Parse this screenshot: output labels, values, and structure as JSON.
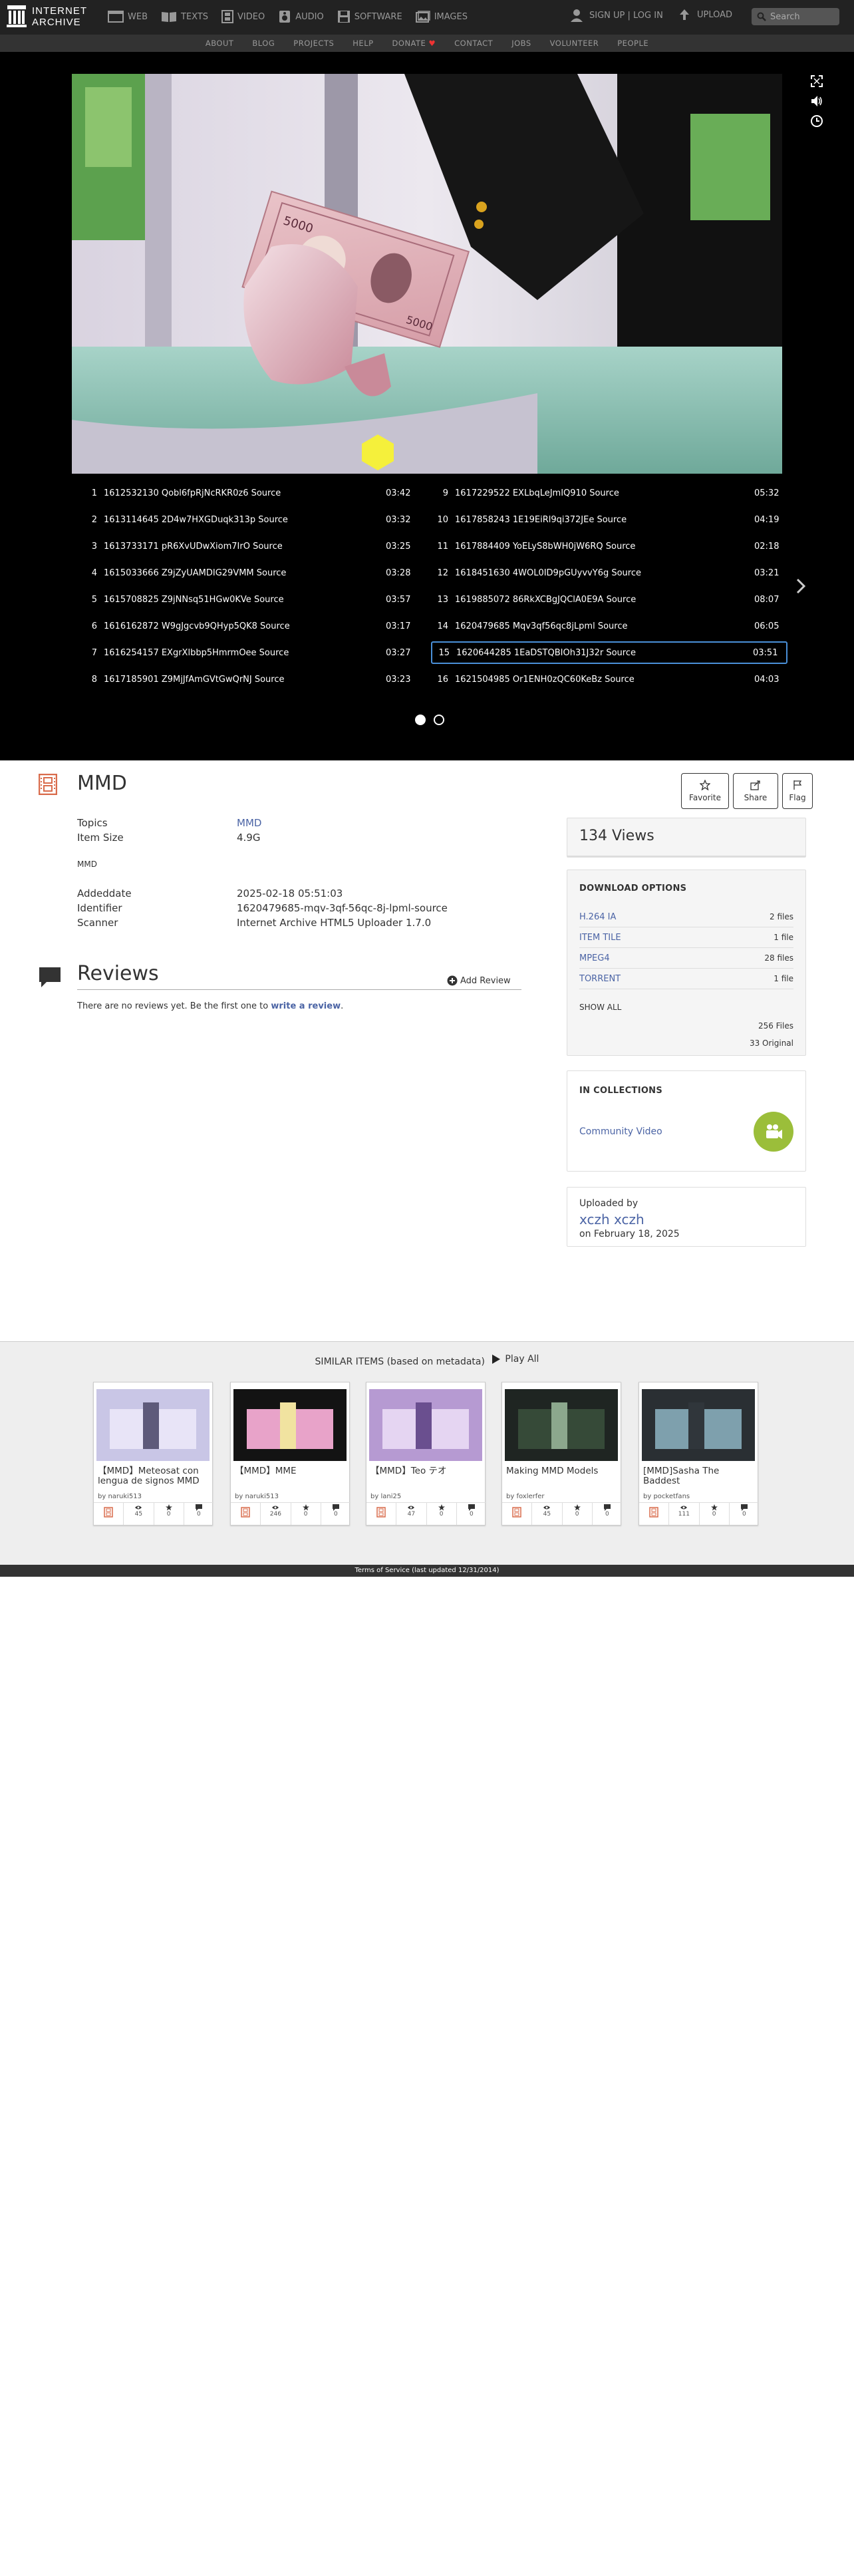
{
  "topnav": {
    "logo_line1": "INTERNET",
    "logo_line2": "ARCHIVE",
    "items": [
      {
        "label": "WEB",
        "icon": "web-icon"
      },
      {
        "label": "TEXTS",
        "icon": "book-icon"
      },
      {
        "label": "VIDEO",
        "icon": "film-icon"
      },
      {
        "label": "AUDIO",
        "icon": "speaker-icon"
      },
      {
        "label": "SOFTWARE",
        "icon": "floppy-icon"
      },
      {
        "label": "IMAGES",
        "icon": "image-icon"
      }
    ],
    "signin": "SIGN UP | LOG IN",
    "upload": "UPLOAD",
    "search_placeholder": "Search"
  },
  "subnav": {
    "items": [
      "ABOUT",
      "BLOG",
      "PROJECTS",
      "HELP",
      "DONATE",
      "CONTACT",
      "JOBS",
      "VOLUNTEER",
      "PEOPLE"
    ]
  },
  "playlist": {
    "items": [
      {
        "num": "1",
        "title": "1612532130 Qobl6fpRjNcRKR0z6 Source",
        "dur": "03:42"
      },
      {
        "num": "2",
        "title": "1613114645 2D4w7HXGDuqk313p Source",
        "dur": "03:32"
      },
      {
        "num": "3",
        "title": "1613733171 pR6XvUDwXiom7IrO Source",
        "dur": "03:25"
      },
      {
        "num": "4",
        "title": "1615033666 Z9jZyUAMDIG29VMM Source",
        "dur": "03:28"
      },
      {
        "num": "5",
        "title": "1615708825 Z9jNNsq51HGw0KVe Source",
        "dur": "03:57"
      },
      {
        "num": "6",
        "title": "1616162872 W9gJgcvb9QHyp5QK8 Source",
        "dur": "03:17"
      },
      {
        "num": "7",
        "title": "1616254157 EXgrXlbbp5HmrmOee Source",
        "dur": "03:27"
      },
      {
        "num": "8",
        "title": "1617185901 Z9MjJfAmGVtGwQrNJ Source",
        "dur": "03:23"
      },
      {
        "num": "9",
        "title": "1617229522 EXLbqLeJmIQ910 Source",
        "dur": "05:32"
      },
      {
        "num": "10",
        "title": "1617858243 1E19EiRl9qi372JEe Source",
        "dur": "04:19"
      },
      {
        "num": "11",
        "title": "1617884409 YoELyS8bWH0jW6RQ Source",
        "dur": "02:18"
      },
      {
        "num": "12",
        "title": "1618451630 4WOL0ID9pGUyvvY6g Source",
        "dur": "03:21"
      },
      {
        "num": "13",
        "title": "1619885072 86RkXCBgJQClA0E9A Source",
        "dur": "08:07"
      },
      {
        "num": "14",
        "title": "1620479685 Mqv3qf56qc8jLpml Source",
        "dur": "06:05"
      },
      {
        "num": "15",
        "title": "1620644285 1EaDSTQBIOh31J32r Source",
        "dur": "03:51",
        "selected": true
      },
      {
        "num": "16",
        "title": "1621504985 Or1ENH0zQC60KeBz Source",
        "dur": "04:03"
      }
    ]
  },
  "item": {
    "title": "MMD",
    "actions": {
      "favorite": "Favorite",
      "share": "Share",
      "flag": "Flag"
    },
    "topics_label": "Topics",
    "topics_value": "MMD",
    "size_label": "Item Size",
    "size_value": "4.9G",
    "description": "MMD",
    "added_label": "Addeddate",
    "added_value": "2025-02-18 05:51:03",
    "identifier_label": "Identifier",
    "identifier_value": "1620479685-mqv-3qf-56qc-8j-lpml-source",
    "scanner_label": "Scanner",
    "scanner_value": "Internet Archive HTML5 Uploader 1.7.0"
  },
  "reviews": {
    "title": "Reviews",
    "add_label": "Add Review",
    "empty_text": "There are no reviews yet. Be the first one to",
    "write_link": "write a review",
    "period": "."
  },
  "sidebar": {
    "views": "134 Views",
    "download_heading": "DOWNLOAD OPTIONS",
    "downloads": [
      {
        "format": "H.264 IA",
        "count": "2 files"
      },
      {
        "format": "ITEM TILE",
        "count": "1 file"
      },
      {
        "format": "MPEG4",
        "count": "28 files"
      },
      {
        "format": "TORRENT",
        "count": "1 file"
      }
    ],
    "show_all": "SHOW ALL",
    "total_files": "256 Files",
    "original": "33 Original",
    "collections_heading": "IN COLLECTIONS",
    "collection": "Community Video",
    "uploaded_by": "Uploaded by",
    "uploader": "xczh xczh",
    "upload_date": "on February 18, 2025"
  },
  "similar": {
    "header": "SIMILAR ITEMS (based on metadata)",
    "play_all": "Play All",
    "tiles": [
      {
        "title": "【MMD】Meteosat con lengua de signos MMD",
        "by": "by naruki513",
        "views": "45",
        "favs": "0",
        "reviews": "0"
      },
      {
        "title": "【MMD】MME",
        "by": "by naruki513",
        "views": "246",
        "favs": "0",
        "reviews": "0"
      },
      {
        "title": "【MMD】Teo テオ",
        "by": "by lani25",
        "views": "47",
        "favs": "0",
        "reviews": "0"
      },
      {
        "title": "Making MMD Models",
        "by": "by foxlerfer",
        "views": "45",
        "favs": "0",
        "reviews": "0"
      },
      {
        "title": "[MMD]Sasha The Baddest",
        "by": "by pocketfans",
        "views": "111",
        "favs": "0",
        "reviews": "0"
      }
    ]
  },
  "footer": {
    "text": "Terms of Service (last updated 12/31/2014)"
  }
}
